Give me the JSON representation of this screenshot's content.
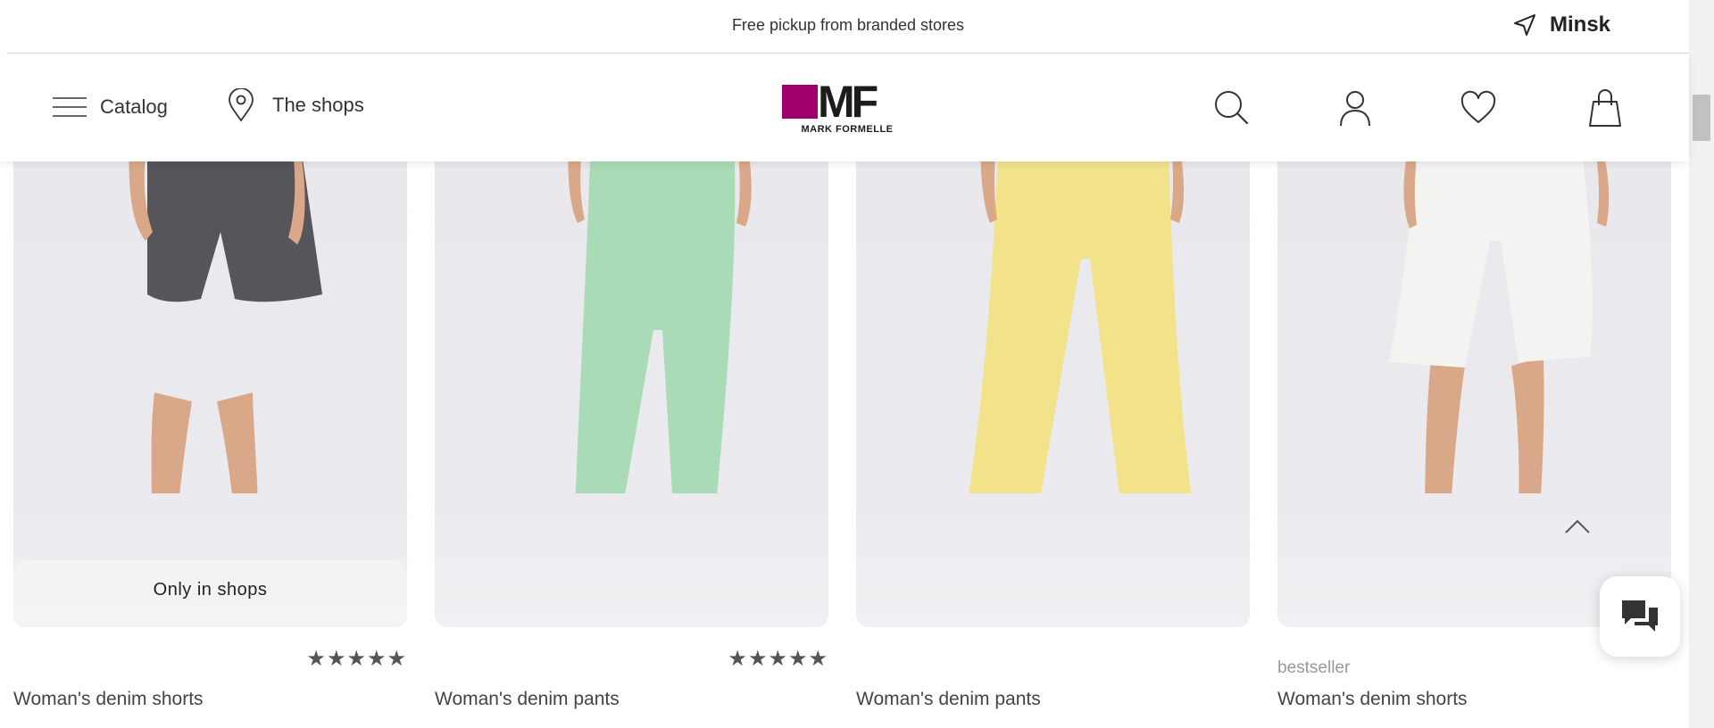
{
  "promo": {
    "text": "Free pickup from branded stores"
  },
  "city": {
    "label": "Minsk",
    "icon": "navigation-arrow-icon"
  },
  "header": {
    "catalog_label": "Catalog",
    "shops_label": "The shops",
    "logo": {
      "mark": "MF",
      "name": "MARK FORMELLE",
      "brand_color": "#a0006e"
    },
    "icons": [
      "search-icon",
      "user-icon",
      "heart-icon",
      "bag-icon"
    ]
  },
  "products": [
    {
      "title": "Woman's denim shorts",
      "badge": "Only in shops",
      "stars": "★★★★★",
      "tag": "",
      "garment_color": "#55555a"
    },
    {
      "title": "Woman's denim pants",
      "badge": "",
      "stars": "★★★★★",
      "tag": "",
      "garment_color": "#a9dbb7"
    },
    {
      "title": "Woman's denim pants",
      "badge": "",
      "stars": "",
      "tag": "",
      "garment_color": "#f2e38a"
    },
    {
      "title": "Woman's denim shorts",
      "badge": "",
      "stars": "",
      "tag": "bestseller",
      "garment_color": "#f3f3f1"
    }
  ],
  "floating": {
    "scroll_up_icon": "chevron-up-icon",
    "chat_icon": "chat-icon"
  }
}
